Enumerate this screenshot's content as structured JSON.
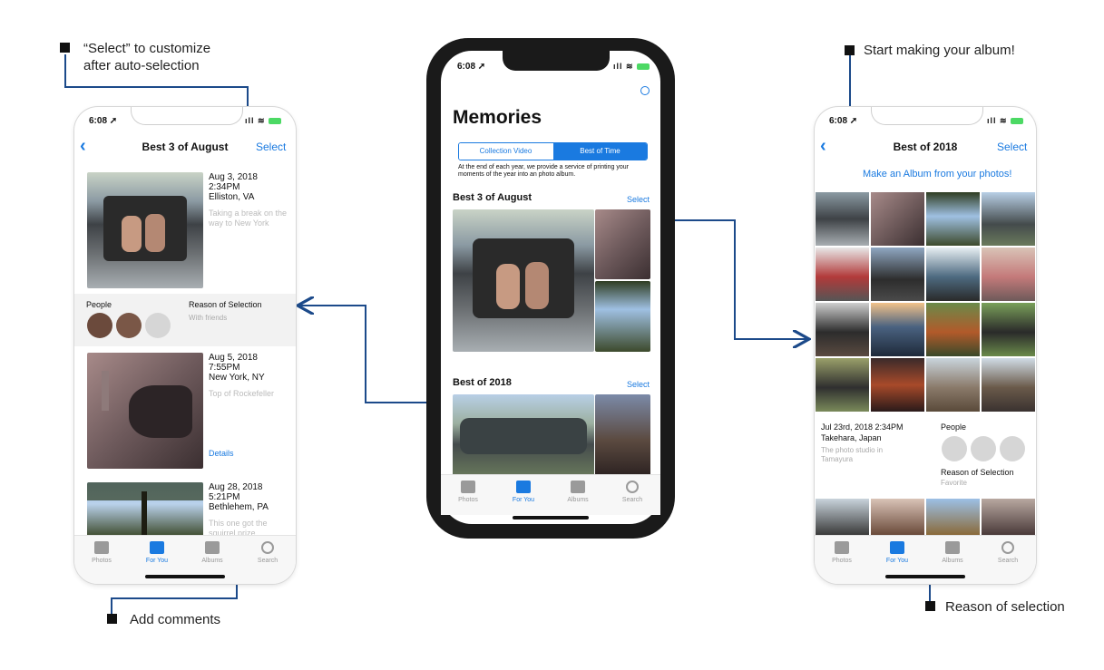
{
  "annotations": {
    "select_line1": "“Select” to customize",
    "select_line2": "after auto-selection",
    "add_comments": "Add comments",
    "start_album": "Start making your album!",
    "reason": "Reason of selection"
  },
  "left_phone": {
    "time": "6:08",
    "title": "Best 3 of August",
    "select": "Select",
    "entries": [
      {
        "date": "Aug 3, 2018",
        "time": "2:34PM",
        "place": "Elliston, VA",
        "caption": "Taking a break on the way to New York"
      },
      {
        "date": "Aug 5, 2018",
        "time": "7:55PM",
        "place": "New York, NY",
        "caption": "Top of Rockefeller",
        "details": "Details"
      },
      {
        "date": "Aug 28, 2018",
        "time": "5:21PM",
        "place": "Bethlehem, PA",
        "caption": "This one got the squirrel prize"
      }
    ],
    "people_label": "People",
    "reason_label": "Reason of Selection",
    "reason_value": "With friends",
    "tabs": [
      "Photos",
      "For You",
      "Albums",
      "Search"
    ]
  },
  "center_phone": {
    "time": "6:08",
    "title": "Memories",
    "segments": [
      "Collection Video",
      "Best of Time"
    ],
    "description": "At the end of each year, we provide a service of printing your moments of the year into an photo album.",
    "sections": [
      {
        "title": "Best 3 of August",
        "select": "Select"
      },
      {
        "title": "Best of 2018",
        "select": "Select"
      }
    ],
    "tabs": [
      "Photos",
      "For You",
      "Albums",
      "Search"
    ]
  },
  "right_phone": {
    "time": "6:08",
    "title": "Best of 2018",
    "select": "Select",
    "make_album": "Make an Album from your photos!",
    "date_time": "Jul 23rd, 2018  2:34PM",
    "place": "Takehara, Japan",
    "caption": "The photo studio in Tamayura",
    "people_label": "People",
    "reason_label": "Reason of Selection",
    "reason_value": "Favorite",
    "tabs": [
      "Photos",
      "For You",
      "Albums",
      "Search"
    ]
  },
  "colors": {
    "accent": "#1a7ae0",
    "connector": "#1c4a8a",
    "active_tab": "#1a7ae0",
    "battery": "#4cd964"
  }
}
